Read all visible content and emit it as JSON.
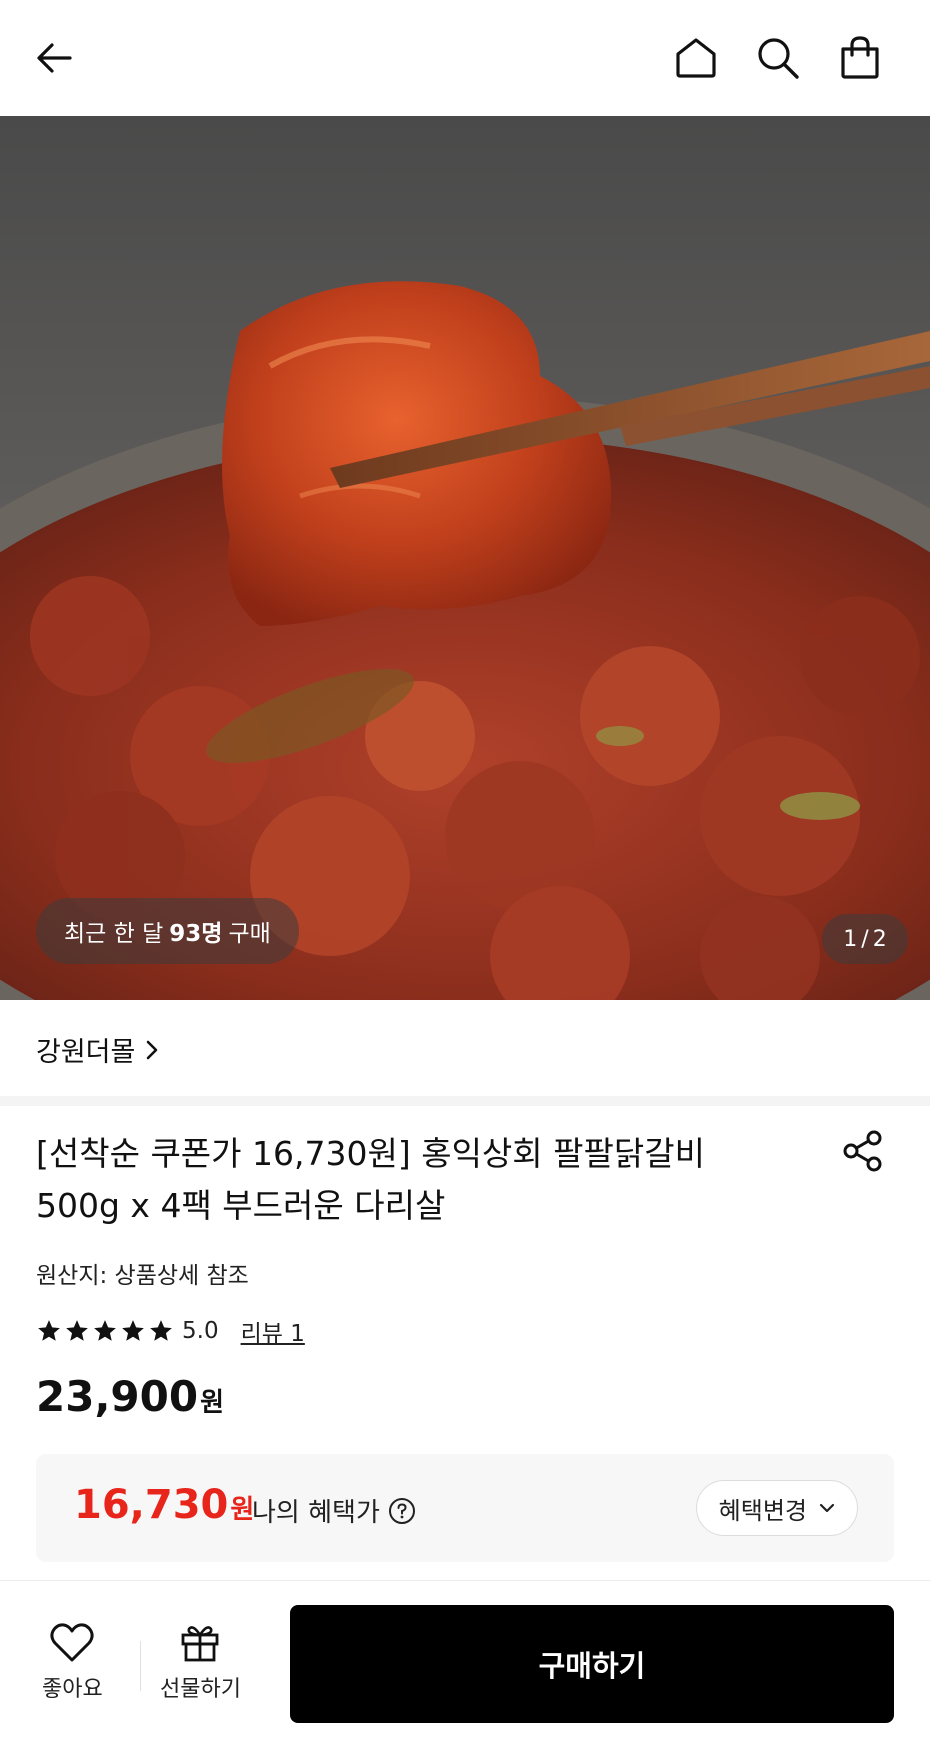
{
  "topbar": {
    "icons": [
      "back-arrow-icon",
      "home-icon",
      "search-icon",
      "shopping-bag-icon"
    ]
  },
  "hero": {
    "recent_prefix": "최근 한 달",
    "recent_count": "93명",
    "recent_suffix": "구매",
    "page_current": "1",
    "page_sep": "/",
    "page_total": "2"
  },
  "store": {
    "name": "강원더몰"
  },
  "product": {
    "title": "[선착순 쿠폰가 16,730원] 홍익상회 팔팔닭갈비 500g x 4팩 부드러운 다리살",
    "origin": "원산지: 상품상세 참조",
    "rating_score": "5.0",
    "rating_stars": 5,
    "review_label": "리뷰 1",
    "price": "23,900",
    "price_unit": "원"
  },
  "benefit": {
    "price": "16,730",
    "price_unit": "원",
    "label": "나의 혜택가",
    "change_label": "혜택변경",
    "accent": "#e8251b"
  },
  "bottombar": {
    "like_label": "좋아요",
    "gift_label": "선물하기",
    "buy_label": "구매하기"
  }
}
